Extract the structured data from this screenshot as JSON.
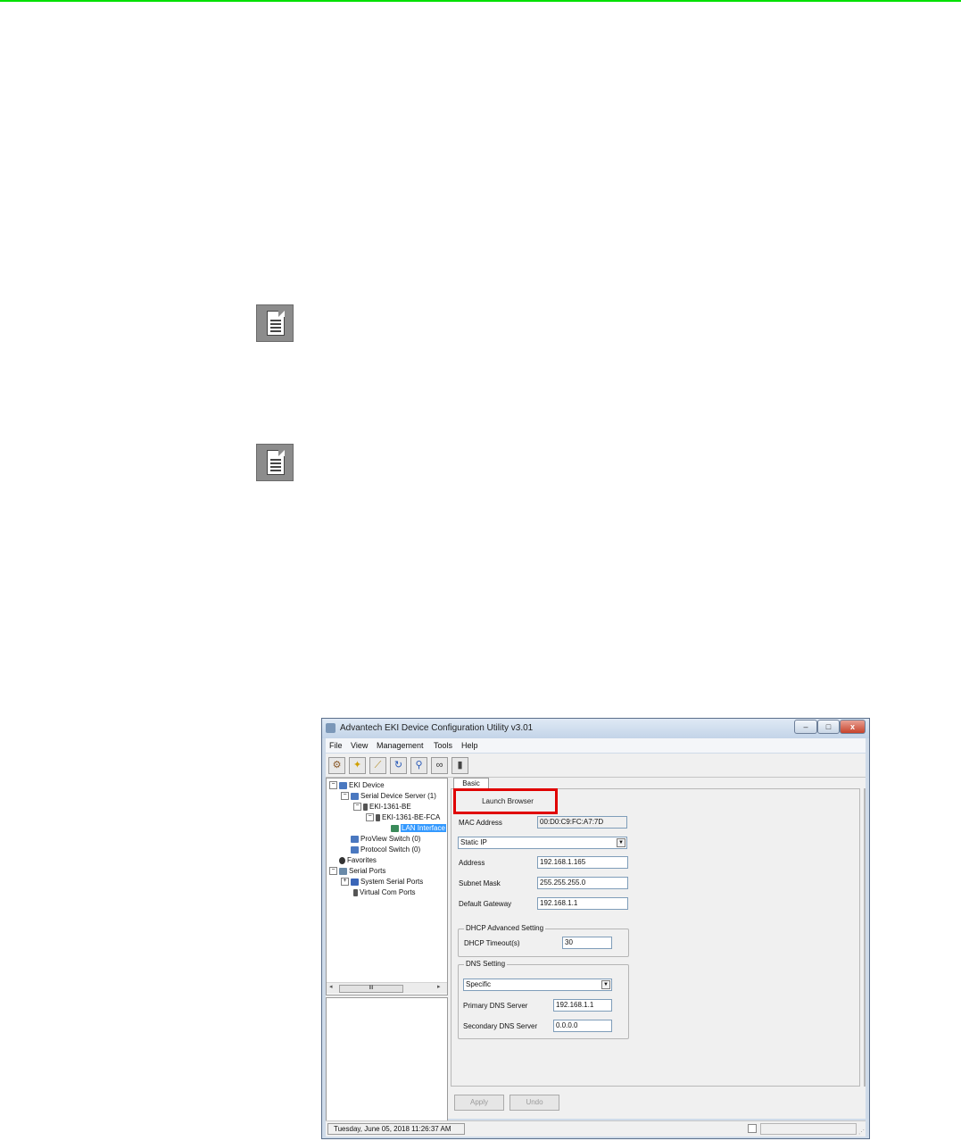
{
  "window": {
    "title": "Advantech EKI Device Configuration Utility v3.01",
    "controls": [
      "–",
      "□",
      "x"
    ]
  },
  "menu": [
    "File",
    "View",
    "Management",
    "Tools",
    "Help"
  ],
  "toolbar_icons": [
    "device-icon",
    "search-sparkle-icon",
    "broom-icon",
    "refresh-icon",
    "magnifier-icon",
    "binoculars-icon",
    "device-column-icon"
  ],
  "tree": {
    "items": [
      {
        "label": "EKI Device",
        "toggle": "⊟"
      },
      {
        "label": "Serial Device Server (1)",
        "toggle": "⊟"
      },
      {
        "label": "EKI-1361-BE",
        "toggle": "⊟"
      },
      {
        "label": "EKI-1361-BE-FCA",
        "toggle": "⊟"
      },
      {
        "label": "LAN Interface",
        "toggle": ""
      },
      {
        "label": "ProView Switch (0)",
        "toggle": ""
      },
      {
        "label": "Protocol Switch (0)",
        "toggle": ""
      },
      {
        "label": "Favorites",
        "toggle": ""
      },
      {
        "label": "Serial Ports",
        "toggle": "⊟"
      },
      {
        "label": "System Serial Ports",
        "toggle": "⊞"
      },
      {
        "label": "Virtual Com Ports",
        "toggle": ""
      }
    ],
    "scroll_thumb": "III"
  },
  "tab": {
    "label": "Basic"
  },
  "basic": {
    "launch_browser": "Launch Browser",
    "mac_label": "MAC Address",
    "mac_value": "00:D0:C9:FC:A7:7D",
    "ip_mode": "Static IP",
    "address_label": "Address",
    "address_value": "192.168.1.165",
    "subnet_label": "Subnet Mask",
    "subnet_value": "255.255.255.0",
    "gateway_label": "Default Gateway",
    "gateway_value": "192.168.1.1",
    "dhcp_group": "DHCP Advanced Setting",
    "dhcp_timeout_label": "DHCP Timeout(s)",
    "dhcp_timeout_value": "30",
    "dns_group": "DNS Setting",
    "dns_mode": "Specific",
    "primary_dns_label": "Primary DNS Server",
    "primary_dns_value": "192.168.1.1",
    "secondary_dns_label": "Secondary DNS Server",
    "secondary_dns_value": "0.0.0.0",
    "apply": "Apply",
    "undo": "Undo"
  },
  "status": {
    "datetime": "Tuesday, June 05, 2018 11:26:37 AM"
  },
  "colors": {
    "highlight": "#e00000",
    "page_rule": "#00e000",
    "selection": "#3399ff"
  }
}
